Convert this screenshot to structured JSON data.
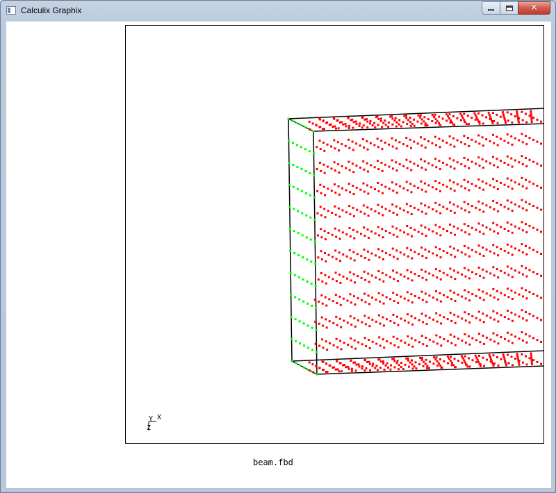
{
  "window": {
    "title": "Calculix Graphix",
    "controls": {
      "minimize": "minimize",
      "maximize": "maximize",
      "close": "close"
    }
  },
  "viewport": {
    "status_text": "beam.fbd",
    "axes": {
      "x": "X",
      "y": "Y",
      "z": "Z"
    },
    "colors": {
      "edge": "#000000",
      "node_red": "#ff0000",
      "node_green": "#00ff00",
      "background": "#ffffff"
    }
  },
  "icons": [
    "app-icon",
    "minimize-icon",
    "maximize-icon",
    "close-icon"
  ]
}
